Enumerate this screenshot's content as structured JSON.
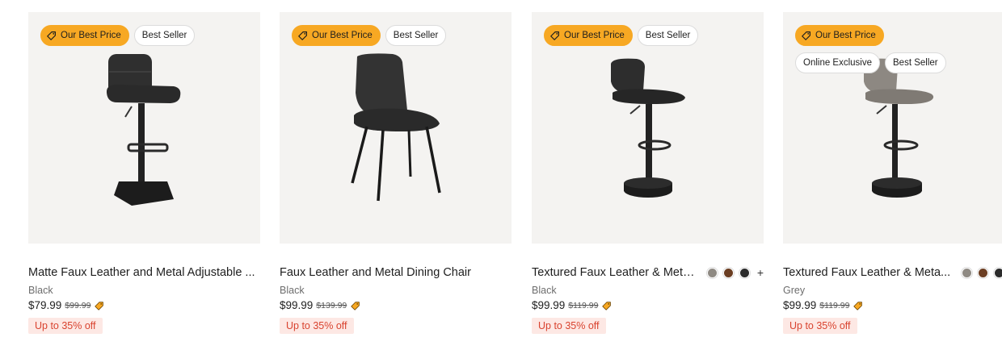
{
  "products": [
    {
      "badges": [
        "Our Best Price",
        "Best Seller"
      ],
      "title": "Matte Faux Leather and Metal Adjustable ...",
      "color": "Black",
      "price": "$79.99",
      "was_price": "$99.99",
      "discount": "Up to 35% off",
      "swatches": [],
      "more": ""
    },
    {
      "badges": [
        "Our Best Price",
        "Best Seller"
      ],
      "title": "Faux Leather and Metal Dining Chair",
      "color": "Black",
      "price": "$99.99",
      "was_price": "$139.99",
      "discount": "Up to 35% off",
      "swatches": [],
      "more": ""
    },
    {
      "badges": [
        "Our Best Price",
        "Best Seller"
      ],
      "title": "Textured Faux Leather & Meta...",
      "color": "Black",
      "price": "$99.99",
      "was_price": "$119.99",
      "discount": "Up to 35% off",
      "swatches": [
        "#8f8a83",
        "#6b3e22",
        "#2b2b2b"
      ],
      "more": "+"
    },
    {
      "badges": [
        "Our Best Price",
        "Online Exclusive",
        "Best Seller"
      ],
      "title": "Textured Faux Leather & Meta...",
      "color": "Grey",
      "price": "$99.99",
      "was_price": "$119.99",
      "discount": "Up to 35% off",
      "swatches": [
        "#8f8a83",
        "#6b3e22",
        "#2b2b2b"
      ],
      "more": ""
    }
  ],
  "colors": {
    "badge_accent": "#f7a823",
    "discount_text": "#d9432f",
    "discount_bg": "#fde8e4",
    "image_bg": "#f4f3f1"
  },
  "icons": {
    "badge": "price-tag-icon",
    "price": "price-tag-icon"
  }
}
